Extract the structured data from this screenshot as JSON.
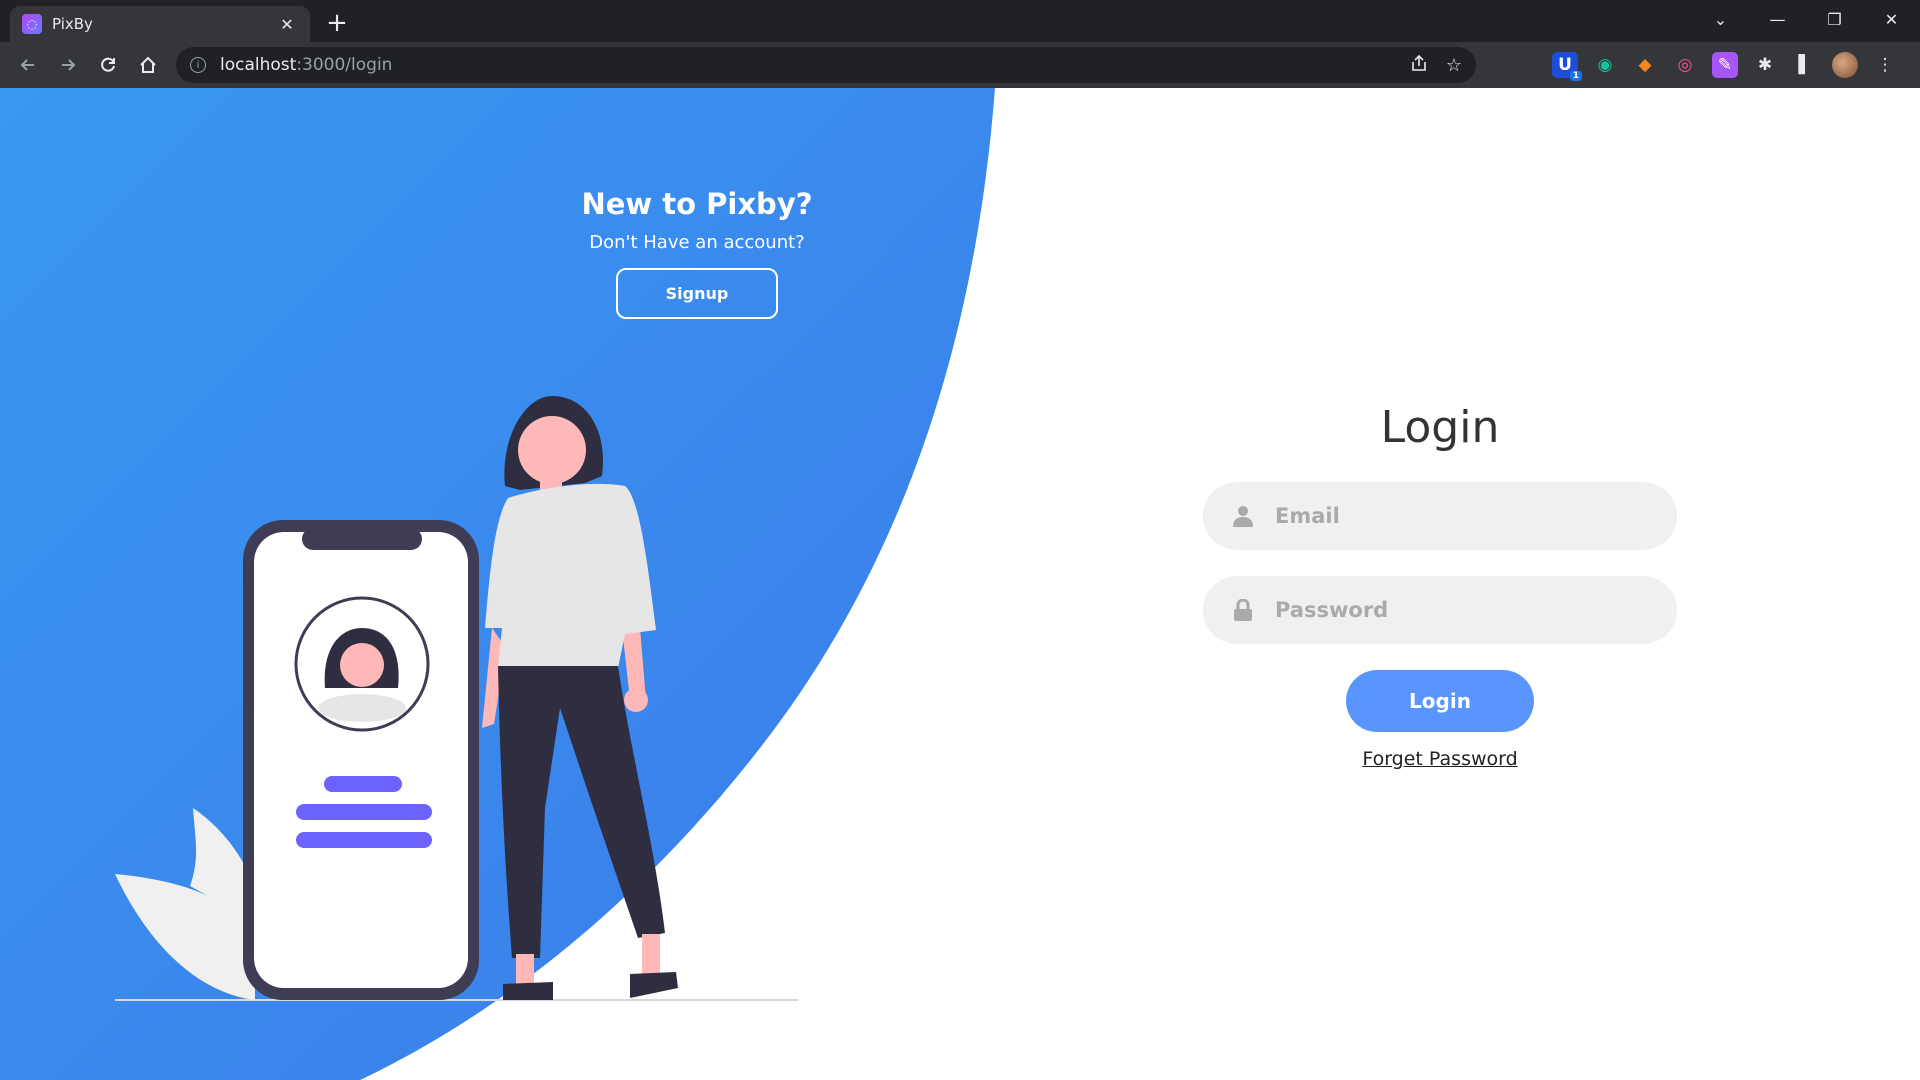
{
  "browser": {
    "tab_title": "PixBy",
    "url_host": "localhost",
    "url_path": ":3000/login",
    "extension_badge": "1"
  },
  "icons": {
    "back": "arrow-left-icon",
    "forward": "arrow-right-icon",
    "reload": "reload-icon",
    "home": "home-icon",
    "info": "info-icon",
    "share": "share-icon",
    "bookmark": "star-icon",
    "email_field": "user-icon",
    "password_field": "lock-icon"
  },
  "promo": {
    "title": "New to Pixby?",
    "subtitle": "Don't Have an account?",
    "signup_label": "Signup"
  },
  "login": {
    "title": "Login",
    "email_placeholder": "Email",
    "password_placeholder": "Password",
    "login_label": "Login",
    "forget_label": "Forget Password"
  },
  "colors": {
    "gradient_start": "#3a98f0",
    "gradient_end": "#3a7bea",
    "primary_button": "#5995fd",
    "field_bg": "#f0f0f0",
    "illustration_accent": "#6c63ff",
    "illustration_dark": "#3f3d56",
    "skin": "#ffb8b8"
  }
}
